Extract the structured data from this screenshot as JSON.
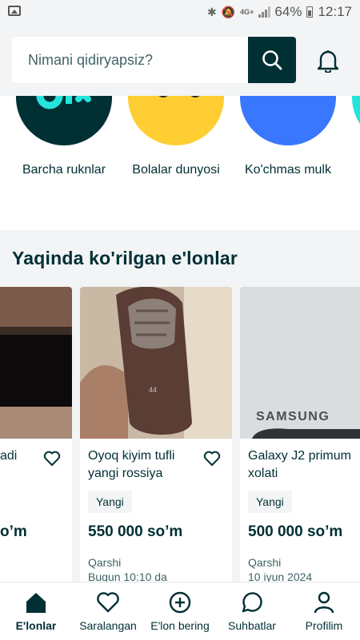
{
  "status_bar": {
    "battery": "64%",
    "time": "12:17",
    "network": "4G+"
  },
  "search": {
    "placeholder": "Nimani qidiryapsiz?"
  },
  "categories": [
    {
      "label": "Barcha ruknlar",
      "color": "#002f34"
    },
    {
      "label": "Bolalar dunyosi",
      "color": "#ffce32"
    },
    {
      "label": "Ko'chmas mulk",
      "color": "#3a77ff"
    },
    {
      "label": "",
      "color": "#23e5db"
    }
  ],
  "recent": {
    "title": "Yaqinda ko'rilgan e'lonlar",
    "cards": [
      {
        "title": "adi",
        "price": "o’m"
      },
      {
        "title": "Oyoq kiyim tufli yangi rossiya",
        "badge": "Yangi",
        "price": "550 000 so’m",
        "location": "Qarshi",
        "date": "Bugun 10:10 da",
        "image_text": "44"
      },
      {
        "title": "Galaxy J2 primum xolati",
        "badge": "Yangi",
        "price": "500 000 so’m",
        "location": "Qarshi",
        "date": "10 iyun 2024",
        "image_text": "SAMSUNG"
      }
    ]
  },
  "bottom_nav": [
    {
      "label": "E'lonlar",
      "icon": "home-icon",
      "active": true
    },
    {
      "label": "Saralangan",
      "icon": "heart-icon"
    },
    {
      "label": "E'lon bering",
      "icon": "plus-circle-icon"
    },
    {
      "label": "Suhbatlar",
      "icon": "chat-icon"
    },
    {
      "label": "Profilim",
      "icon": "person-icon"
    }
  ]
}
